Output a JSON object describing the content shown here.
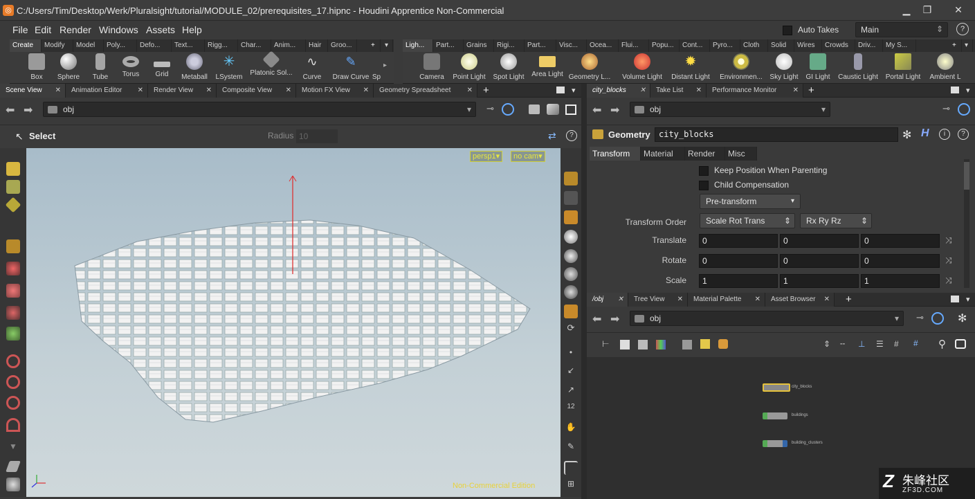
{
  "window": {
    "title": "C:/Users/Tim/Desktop/Werk/Pluralsight/tutorial/MODULE_02/prerequisites_17.hipnc - Houdini Apprentice Non-Commercial",
    "app_icon": "houdini-icon"
  },
  "menu": [
    "File",
    "Edit",
    "Render",
    "Windows",
    "Assets",
    "Help"
  ],
  "auto_takes": "Auto Takes",
  "desktop": "Main",
  "shelf_left": {
    "tabs": [
      "Create",
      "Modify",
      "Model",
      "Poly...",
      "Defo...",
      "Text...",
      "Rigg...",
      "Char...",
      "Anim...",
      "Hair",
      "Groo..."
    ],
    "tools": [
      "Box",
      "Sphere",
      "Tube",
      "Torus",
      "Grid",
      "Metaball",
      "LSystem",
      "Platonic Sol...",
      "Curve",
      "Draw Curve",
      "Sp"
    ]
  },
  "shelf_right": {
    "tabs": [
      "Ligh...",
      "Part...",
      "Grains",
      "Rigi...",
      "Part...",
      "Visc...",
      "Ocea...",
      "Flui...",
      "Popu...",
      "Cont...",
      "Pyro...",
      "Cloth",
      "Solid",
      "Wires",
      "Crowds",
      "Driv...",
      "My S..."
    ],
    "tools": [
      "Camera",
      "Point Light",
      "Spot Light",
      "Area Light",
      "Geometry L...",
      "Volume Light",
      "Distant Light",
      "Environmen...",
      "Sky Light",
      "GI Light",
      "Caustic Light",
      "Portal Light",
      "Ambient L"
    ]
  },
  "left_pane": {
    "tabs": [
      "Scene View",
      "Animation Editor",
      "Render View",
      "Composite View",
      "Motion FX View",
      "Geometry Spreadsheet"
    ],
    "path": "obj",
    "select_label": "Select",
    "radius_label": "Radius",
    "radius_value": "10",
    "camera": "persp1",
    "cam_mode": "no cam",
    "watermark": "Non-Commercial Edition"
  },
  "param_pane": {
    "tabs": [
      "city_blocks",
      "Take List",
      "Performance Monitor"
    ],
    "path": "obj",
    "node_type": "Geometry",
    "node_name": "city_blocks",
    "subtabs": [
      "Transform",
      "Material",
      "Render",
      "Misc"
    ],
    "keep_position": "Keep Position When Parenting",
    "child_comp": "Child Compensation",
    "pretransform": "Pre-transform",
    "transform_order_label": "Transform Order",
    "transform_order": "Scale Rot Trans",
    "rot_order": "Rx Ry Rz",
    "translate_label": "Translate",
    "translate": [
      "0",
      "0",
      "0"
    ],
    "rotate_label": "Rotate",
    "rotate": [
      "0",
      "0",
      "0"
    ],
    "scale_label": "Scale",
    "scale": [
      "1",
      "1",
      "1"
    ]
  },
  "network_pane": {
    "tabs": [
      "/obj",
      "Tree View",
      "Material Palette",
      "Asset Browser"
    ],
    "path": "obj",
    "nodes": [
      "city_blocks",
      "buildings",
      "building_clusters"
    ]
  },
  "corner_watermark": "朱峰社区",
  "corner_watermark_sub": "ZF3D.COM"
}
